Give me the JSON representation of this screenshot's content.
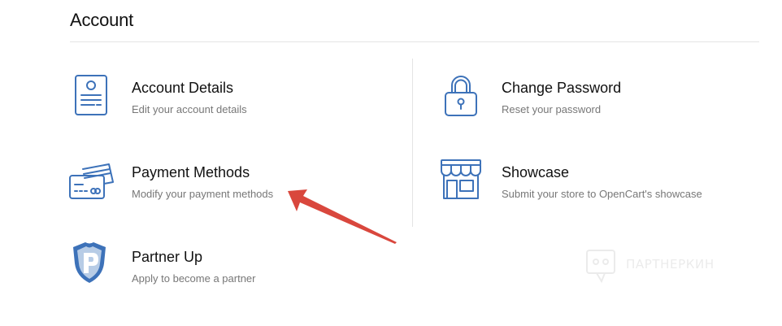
{
  "header": {
    "title": "Account"
  },
  "cards": {
    "account_details": {
      "title": "Account Details",
      "description": "Edit your account details",
      "icon": "id-card-icon"
    },
    "change_password": {
      "title": "Change Password",
      "description": "Reset your password",
      "icon": "padlock-icon"
    },
    "payment_methods": {
      "title": "Payment Methods",
      "description": "Modify your payment methods",
      "icon": "credit-cards-icon"
    },
    "showcase": {
      "title": "Showcase",
      "description": "Submit your store to OpenCart's showcase",
      "icon": "storefront-icon"
    },
    "partner_up": {
      "title": "Partner Up",
      "description": "Apply to become a partner",
      "icon": "partner-shield-icon"
    }
  },
  "watermark": {
    "text": "ПАРТНЕРКИН"
  },
  "colors": {
    "icon_stroke": "#3d72b9",
    "annotation_arrow": "#d9473d",
    "divider": "#e4e4e4"
  }
}
